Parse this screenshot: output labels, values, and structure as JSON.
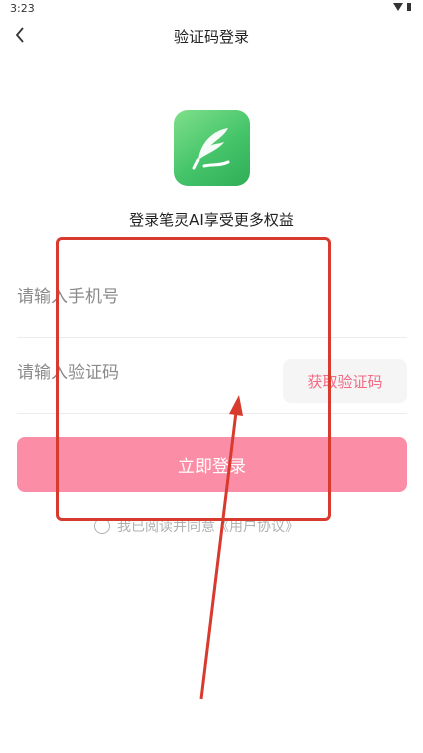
{
  "status_bar": {
    "time": "3:23",
    "wifi_icon": "wifi-icon",
    "battery_icon": "battery-icon"
  },
  "nav": {
    "title": "验证码登录",
    "back_icon": "chevron-left-icon"
  },
  "logo": {
    "icon": "feather-logo-icon",
    "colors": [
      "#7ee08a",
      "#2fae57"
    ]
  },
  "tagline": "登录笔灵AI享受更多权益",
  "form": {
    "phone_placeholder": "请输入手机号",
    "code_placeholder": "请输入验证码",
    "get_code_label": "获取验证码",
    "login_label": "立即登录"
  },
  "agreement": {
    "prefix": "我已阅读并同意",
    "link": "《用户协议》"
  },
  "colors": {
    "accent": "#fb8ea6",
    "get_code_text": "#f36a85",
    "annotation": "#d93a2e"
  }
}
